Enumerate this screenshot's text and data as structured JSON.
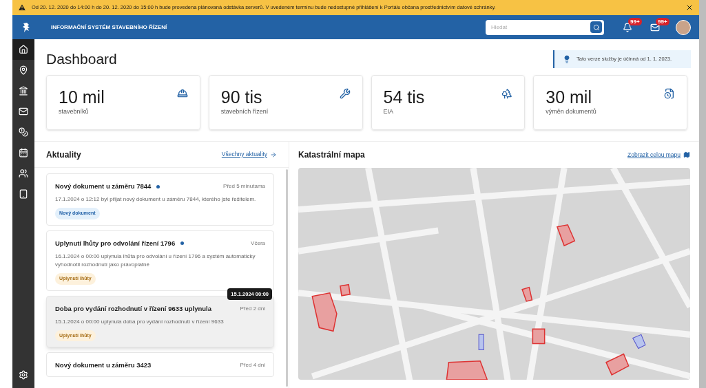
{
  "banner": {
    "text": "Od 20. 12. 2020 do 14:00 h do 20. 12. 2020 do 15:00 h bude provedena plánovaná odstávka serverů. V uvedeném termínu bude nedostupné přihlášení k Portálu občana prostřednictvím datové schránky."
  },
  "header": {
    "title": "INFORMAČNÍ SYSTÉM STAVEBNÍHO ŘÍZENÍ",
    "search": {
      "placeholder": "Hledat"
    },
    "notifications_badge": "99+",
    "messages_badge": "99+"
  },
  "sidebar": {
    "items": [
      {
        "kind": "home",
        "selected": true
      },
      {
        "kind": "pin",
        "selected": false
      },
      {
        "kind": "building",
        "selected": false
      },
      {
        "kind": "mail",
        "selected": false
      },
      {
        "kind": "coins",
        "selected": false
      },
      {
        "kind": "calendar",
        "selected": false
      },
      {
        "kind": "users",
        "selected": false
      },
      {
        "kind": "tablet",
        "selected": false
      }
    ]
  },
  "page": {
    "title": "Dashboard",
    "notice": "Tato verze služby je účinná od 1. 1. 2023."
  },
  "stats": [
    {
      "value": "10 mil",
      "label": "stavebníků",
      "kind": "builders"
    },
    {
      "value": "90 tis",
      "label": "stavebních řízení",
      "kind": "tools"
    },
    {
      "value": "54 tis",
      "label": "EIA",
      "kind": "trees"
    },
    {
      "value": "30 mil",
      "label": "výměn dokumentů",
      "kind": "document"
    }
  ],
  "news": {
    "title": "Aktuality",
    "link": "Všechny aktuality",
    "items": [
      {
        "title": "Nový dokument u záměru 7844",
        "unread": true,
        "time": "Před 5 minutama",
        "body": "17.1.2024 o 12:12 byl přijat nový dokument u záměru 7844, kterého jste řešitelem.",
        "tag": "Nový dokument",
        "kind": "new",
        "hovered": false
      },
      {
        "title": "Uplynutí lhůty pro odvolání řízení 1796",
        "unread": true,
        "time": "Včera",
        "body": "16.1.2024 o 00:00 uplynula lhůta pro odvolání u řízení 1796 a systém automaticky vyhodnotil rozhodnutí jako právoplatné",
        "tag": "Uplynutí lhůty",
        "kind": "deadline",
        "hovered": false
      },
      {
        "title": "Doba pro vydání rozhodnutí v řízení 9633 uplynula",
        "unread": false,
        "time": "Před 2 dni",
        "body": "15.1.2024 o 00:00 uplynula doba pro vydání rozhodnutí v řízení 9633",
        "tag": "Uplynutí lhůty",
        "kind": "deadline",
        "hovered": true,
        "tooltip": "15.1.2024 00:00"
      },
      {
        "title": "Nový dokument u záměru 3423",
        "unread": false,
        "time": "Před 4 dni",
        "hovered": false
      }
    ]
  },
  "map": {
    "title": "Katastrální mapa",
    "link": "Zobrazit celou mapu"
  }
}
